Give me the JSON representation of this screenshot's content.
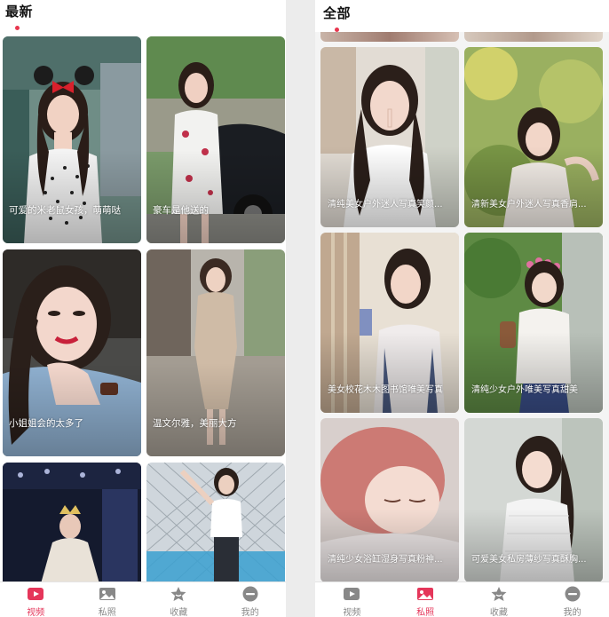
{
  "colors": {
    "accent": "#e5365a",
    "inactive": "#888888",
    "indicator": "#e8374f"
  },
  "latest_screen": {
    "title": "最新",
    "cards": [
      {
        "caption": "可爱的米老鼠女孩，萌萌哒",
        "image": "girl-polka-dress-minnie-ears"
      },
      {
        "caption": "豪车是他送的",
        "image": "girl-qipao-by-black-car"
      },
      {
        "caption": "小姐姐会的太多了",
        "image": "girl-closeup-blue-sweater"
      },
      {
        "caption": "温文尔雅，美丽大方",
        "image": "girl-beige-dress-street"
      },
      {
        "caption": "",
        "image": "girl-stage-gown"
      },
      {
        "caption": "",
        "image": "girl-white-top-fence"
      }
    ],
    "tabs": [
      {
        "label": "视频",
        "icon": "video-icon",
        "active": true
      },
      {
        "label": "私照",
        "icon": "photo-icon",
        "active": false
      },
      {
        "label": "收藏",
        "icon": "star-icon",
        "active": false
      },
      {
        "label": "我的",
        "icon": "profile-icon",
        "active": false
      }
    ]
  },
  "all_screen": {
    "title": "全部",
    "cards": [
      {
        "caption": "清纯美女户外迷人写真笑颜...",
        "image": "girl-finger-to-lips"
      },
      {
        "caption": "清新美女户外迷人写真香肩...",
        "image": "girl-sunlit-garden"
      },
      {
        "caption": "美女校花木木图书馆唯美写真",
        "image": "girl-library-book"
      },
      {
        "caption": "清纯少女户外唯美写真甜美",
        "image": "girl-flower-crown-path"
      },
      {
        "caption": "清纯少女浴缸湿身写真粉神...",
        "image": "girl-bath-sleeping"
      },
      {
        "caption": "可爱美女私房薄纱写真酥胸...",
        "image": "girl-white-lace-window"
      }
    ],
    "tabs": [
      {
        "label": "视频",
        "icon": "video-icon",
        "active": false
      },
      {
        "label": "私照",
        "icon": "photo-icon",
        "active": true
      },
      {
        "label": "收藏",
        "icon": "star-icon",
        "active": false
      },
      {
        "label": "我的",
        "icon": "profile-icon",
        "active": false
      }
    ]
  }
}
